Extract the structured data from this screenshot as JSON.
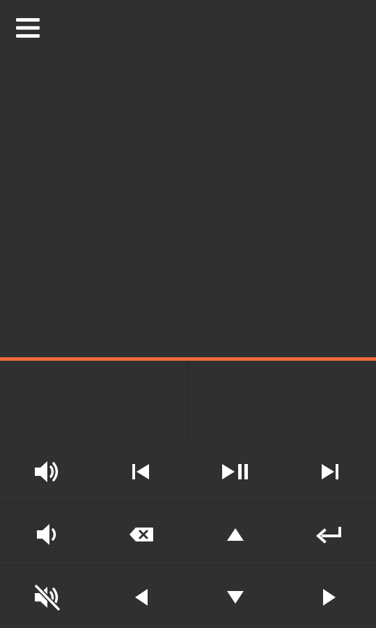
{
  "app": {
    "accent_color": "#f26b3a",
    "background_color": "#303030",
    "icon_color": "#ffffff"
  },
  "header": {
    "menu_icon": "hamburger-menu-icon"
  },
  "touchpad": {
    "left_click": "mouse-left-click",
    "right_click": "mouse-right-click"
  },
  "controls": {
    "rows": [
      [
        "volume-up-icon",
        "skip-previous-icon",
        "play-pause-icon",
        "skip-next-icon"
      ],
      [
        "volume-down-icon",
        "backspace-icon",
        "arrow-up-icon",
        "enter-icon"
      ],
      [
        "volume-mute-icon",
        "arrow-left-icon",
        "arrow-down-icon",
        "arrow-right-icon"
      ]
    ]
  }
}
